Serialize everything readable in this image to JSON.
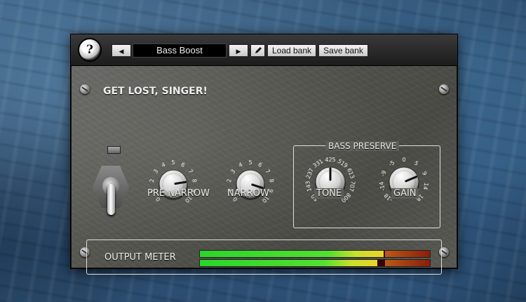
{
  "toolbar": {
    "help_icon": "help-icon",
    "help_glyph": "?",
    "prev_glyph": "◀",
    "next_glyph": "▶",
    "preset_name": "Bass Boost",
    "edit_icon": "pencil-icon",
    "load_bank": "Load bank",
    "save_bank": "Save bank"
  },
  "panel": {
    "title": "GET LOST, SINGER!",
    "switch_state": "down",
    "knobs": {
      "pre_narrow": {
        "label": "PRE NARROW",
        "ticks": [
          "0",
          "1",
          "2",
          "3",
          "4",
          "5",
          "6",
          "7",
          "8",
          "9",
          "10"
        ],
        "value": 8
      },
      "narrow": {
        "label": "NARROW",
        "ticks": [
          "0",
          "1",
          "2",
          "3",
          "4",
          "5",
          "6",
          "7",
          "8",
          "9",
          "10"
        ],
        "value": 9
      }
    },
    "bass_preserve": {
      "title": "BASS PRESERVE",
      "tone": {
        "label": "TONE",
        "ticks": [
          "50",
          "143",
          "237",
          "331",
          "425",
          "519",
          "613",
          "707",
          "800"
        ],
        "value": 425
      },
      "gain": {
        "label": "GAIN",
        "ticks": [
          "-18",
          "-14",
          "-9",
          "-5",
          "0",
          "5",
          "9",
          "14",
          "18"
        ],
        "value": 9
      }
    },
    "output_meter": {
      "label": "OUTPUT METER",
      "levels": [
        0.8,
        0.77
      ]
    }
  },
  "colors": {
    "meter_green": "#2bd52b",
    "meter_yellow": "#e8d62a",
    "meter_red": "#8a1d0a",
    "panel_metal": "#5a5a55"
  }
}
